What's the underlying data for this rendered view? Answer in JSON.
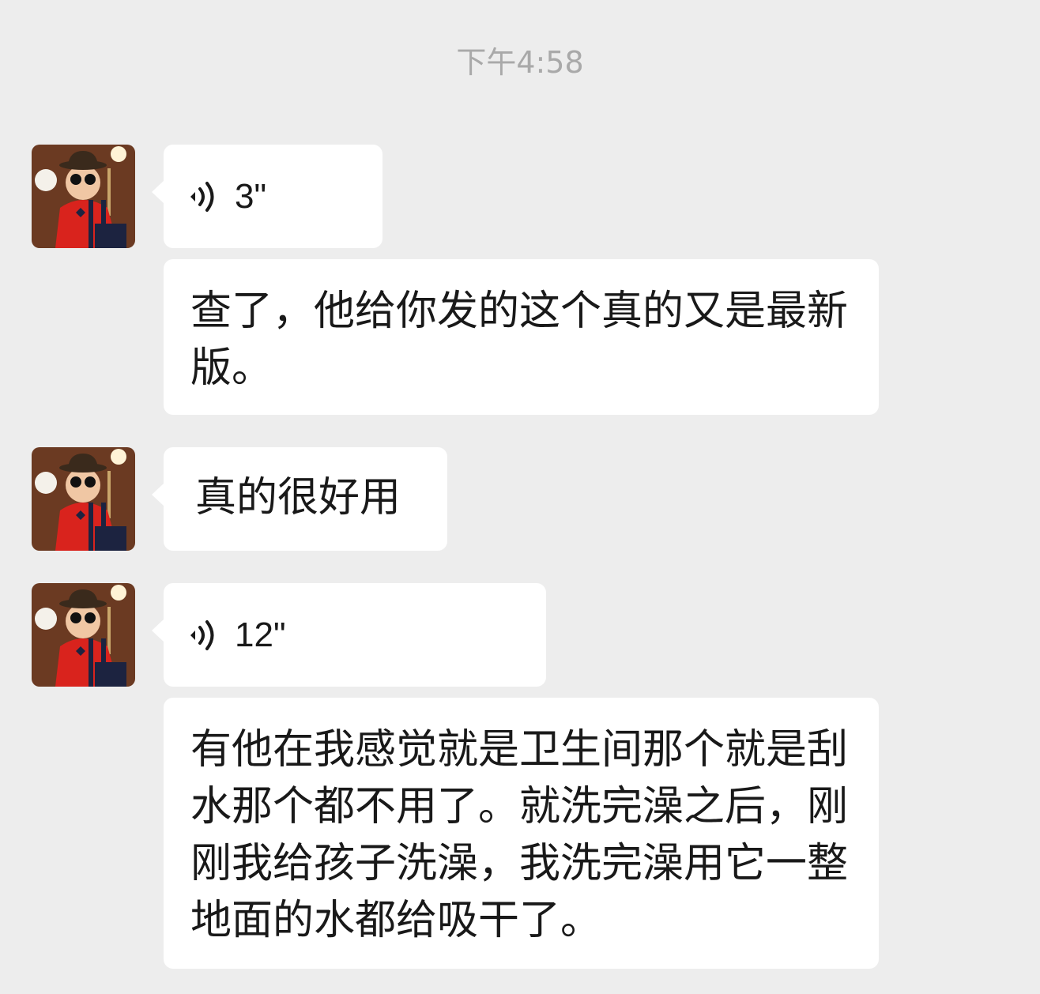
{
  "chat": {
    "timestamp": "下午4:58",
    "messages": [
      {
        "type": "voice",
        "duration": "3\""
      },
      {
        "type": "text",
        "text": "查了，他给你发的这个真的又是最新版。"
      },
      {
        "type": "text",
        "text": "真的很好用"
      },
      {
        "type": "voice",
        "duration": "12\""
      },
      {
        "type": "text",
        "text": "有他在我感觉就是卫生间那个就是刮水那个都不用了。就洗完澡之后，刚刚我给孩子洗澡，我洗完澡用它一整地面的水都给吸干了。"
      }
    ]
  },
  "icons": {
    "voice": "voice-play-icon",
    "avatar": "contact-avatar"
  },
  "colors": {
    "background": "#ededed",
    "bubble": "#ffffff",
    "timestamp": "#a9a9a9",
    "text": "#191919"
  }
}
